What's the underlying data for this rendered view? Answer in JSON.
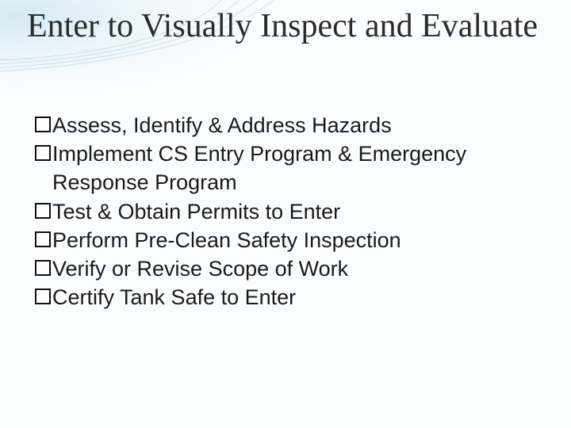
{
  "slide": {
    "title": "Enter to Visually Inspect and Evaluate",
    "bullets": [
      "Assess, Identify & Address Hazards",
      "Implement CS Entry Program & Emergency Response Program",
      "Test & Obtain Permits to Enter",
      "Perform Pre-Clean Safety Inspection",
      "Verify or Revise Scope of Work",
      "Certify Tank Safe to Enter"
    ]
  }
}
